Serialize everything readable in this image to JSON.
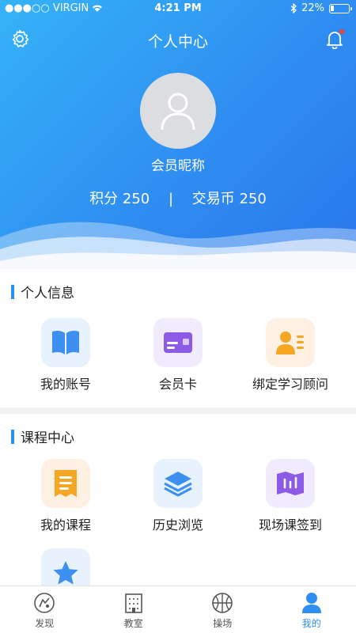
{
  "status_bar": {
    "carrier": "●●●○○ VIRGIN",
    "time": "4:21 PM",
    "battery": "22%",
    "battery_level": 0.22
  },
  "nav": {
    "title": "个人中心"
  },
  "profile": {
    "nickname": "会员昵称",
    "points_label": "积分 250",
    "separator": "|",
    "coins_label": "交易币 250"
  },
  "sections": [
    {
      "title": "个人信息",
      "items": [
        {
          "label": "我的账号",
          "icon": "book-icon"
        },
        {
          "label": "会员卡",
          "icon": "card-icon"
        },
        {
          "label": "绑定学习顾问",
          "icon": "advisor-icon"
        }
      ]
    },
    {
      "title": "课程中心",
      "items": [
        {
          "label": "我的课程",
          "icon": "course-icon"
        },
        {
          "label": "历史浏览",
          "icon": "layers-icon"
        },
        {
          "label": "现场课签到",
          "icon": "map-icon"
        },
        {
          "label": "",
          "icon": "star-icon"
        }
      ]
    }
  ],
  "tabbar": [
    {
      "label": "发现",
      "icon": "discover-icon"
    },
    {
      "label": "教室",
      "icon": "classroom-icon"
    },
    {
      "label": "操场",
      "icon": "basketball-icon"
    },
    {
      "label": "我的",
      "icon": "profile-icon"
    }
  ],
  "colors": {
    "brand": "#2f8ef1",
    "hero_start": "#35b3f7",
    "notification_dot": "#ff3b30"
  }
}
